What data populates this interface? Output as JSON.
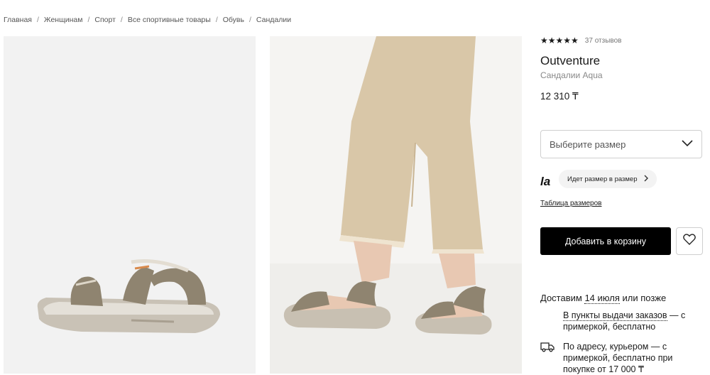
{
  "breadcrumb": [
    "Главная",
    "Женщинам",
    "Спорт",
    "Все спортивные товары",
    "Обувь",
    "Сандалии"
  ],
  "product": {
    "stars": "★★★★★",
    "rating_value": 5,
    "reviews": "37 отзывов",
    "brand": "Outventure",
    "model": "Сандалии Aqua",
    "price": "12 310 ₸"
  },
  "size": {
    "placeholder": "Выберите размер",
    "fit_logo": "la",
    "fit_text": "Идет размер в размер",
    "size_table": "Таблица размеров"
  },
  "actions": {
    "add_to_cart": "Добавить в корзину"
  },
  "delivery": {
    "prefix": "Доставим ",
    "date": "14 июля",
    "suffix": " или позже",
    "pickup_link": "В пункты выдачи заказов",
    "pickup_rest": " — с примеркой, бесплатно",
    "courier": "По адресу, курьером — с примеркой, бесплатно при покупке от 17 000 ₸"
  },
  "colors": {
    "accent": "#000000",
    "sandal_strap": "#8f8470",
    "pants": "#d9c7a8"
  },
  "icons": [
    "chevron-down-icon",
    "chevron-right-icon",
    "heart-icon",
    "truck-icon",
    "star-icon"
  ]
}
